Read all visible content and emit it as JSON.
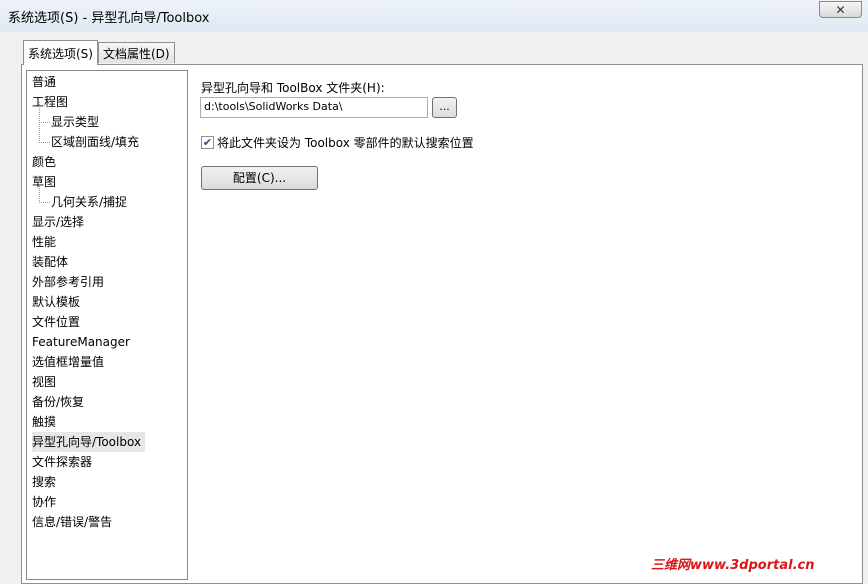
{
  "window": {
    "title": "系统选项(S) - 异型孔向导/Toolbox",
    "close_glyph": "✕"
  },
  "tabs": [
    {
      "label": "系统选项(S)",
      "active": true
    },
    {
      "label": "文档属性(D)",
      "active": false
    }
  ],
  "tree": {
    "items": [
      {
        "label": "普通"
      },
      {
        "label": "工程图"
      },
      {
        "label": "显示类型"
      },
      {
        "label": "区域剖面线/填充"
      },
      {
        "label": "颜色"
      },
      {
        "label": "草图"
      },
      {
        "label": "几何关系/捕捉"
      },
      {
        "label": "显示/选择"
      },
      {
        "label": "性能"
      },
      {
        "label": "装配体"
      },
      {
        "label": "外部参考引用"
      },
      {
        "label": "默认模板"
      },
      {
        "label": "文件位置"
      },
      {
        "label": "FeatureManager"
      },
      {
        "label": "选值框增量值"
      },
      {
        "label": "视图"
      },
      {
        "label": "备份/恢复"
      },
      {
        "label": "触摸"
      },
      {
        "label": "异型孔向导/Toolbox"
      },
      {
        "label": "文件探索器"
      },
      {
        "label": "搜索"
      },
      {
        "label": "协作"
      },
      {
        "label": "信息/错误/警告"
      }
    ],
    "selected": "异型孔向导/Toolbox"
  },
  "content": {
    "folder_label": "异型孔向导和 ToolBox 文件夹(H):",
    "folder_path": "d:\\tools\\SolidWorks Data\\",
    "browse_label": "...",
    "default_search_checkbox": {
      "checked": true,
      "glyph": "✔",
      "label": "将此文件夹设为 Toolbox 零部件的默认搜索位置"
    },
    "configure_button": "配置(C)..."
  },
  "watermark": "三维网www.3dportal.cn"
}
